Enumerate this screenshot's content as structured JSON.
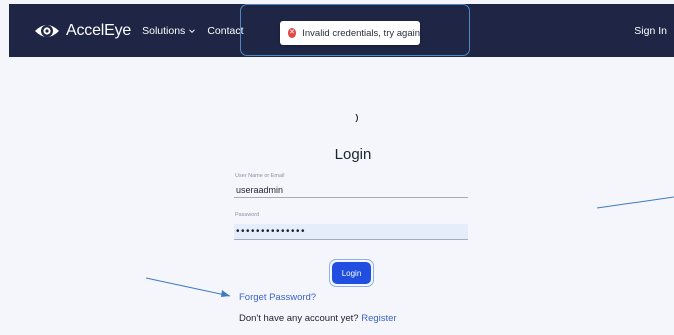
{
  "header": {
    "brand": "AccelEye",
    "nav": {
      "solutions": "Solutions",
      "contact": "Contact",
      "sign_in": "Sign In"
    }
  },
  "toast": {
    "message": "Invalid credentials, try again",
    "icon": "error-x-icon",
    "icon_color": "#e04848"
  },
  "login": {
    "title": "Login",
    "username_label": "User Name or Email",
    "username_value": "useraadmin",
    "password_label": "Password",
    "password_value": "••••••••••••••",
    "submit_label": "Login",
    "forgot_label": "Forget Password?",
    "no_account_text": "Don't have any account yet?",
    "register_label": "Register"
  },
  "colors": {
    "navbar_bg": "#1e2545",
    "primary_button": "#1f4ee0",
    "link": "#3b64c9",
    "page_bg": "#f4f6fb"
  }
}
